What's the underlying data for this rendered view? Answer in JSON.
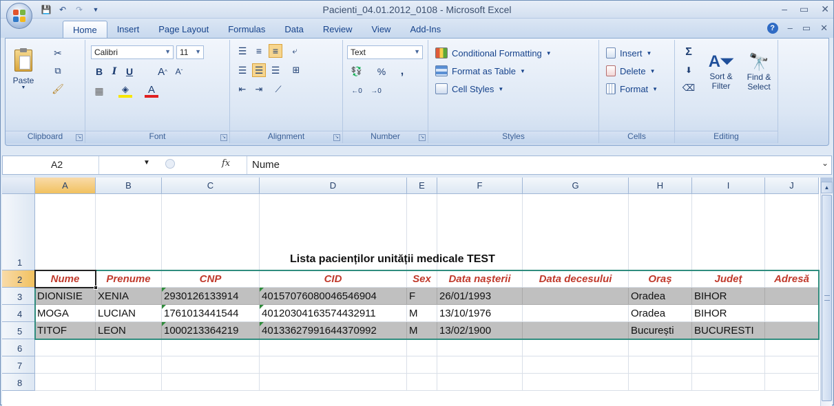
{
  "window": {
    "title": "Pacienti_04.01.2012_0108 - Microsoft Excel"
  },
  "tabs": [
    "Home",
    "Insert",
    "Page Layout",
    "Formulas",
    "Data",
    "Review",
    "View",
    "Add-Ins"
  ],
  "ribbon": {
    "clipboard": {
      "label": "Clipboard",
      "paste": "Paste"
    },
    "font": {
      "label": "Font",
      "name": "Calibri",
      "size": "11"
    },
    "alignment": {
      "label": "Alignment"
    },
    "number": {
      "label": "Number",
      "format": "Text",
      "percent": "%",
      "comma": ","
    },
    "styles": {
      "label": "Styles",
      "conditional": "Conditional Formatting",
      "format_table": "Format as Table",
      "cell_styles": "Cell Styles"
    },
    "cells": {
      "label": "Cells",
      "insert": "Insert",
      "delete": "Delete",
      "format": "Format"
    },
    "editing": {
      "label": "Editing",
      "sort_filter": "Sort &",
      "sort_filter2": "Filter",
      "find_select": "Find &",
      "find_select2": "Select"
    }
  },
  "formula_bar": {
    "name_box": "A2",
    "fx": "fx",
    "content": "Nume"
  },
  "columns": [
    "A",
    "B",
    "C",
    "D",
    "E",
    "F",
    "G",
    "H",
    "I",
    "J"
  ],
  "rows": [
    "1",
    "2",
    "3",
    "4",
    "5",
    "6",
    "7",
    "8"
  ],
  "sheet": {
    "title": "Lista pacienților unității medicale TEST",
    "headers": [
      "Nume",
      "Prenume",
      "CNP",
      "CID",
      "Sex",
      "Data nașterii",
      "Data decesului",
      "Oraș",
      "Județ",
      "Adresă"
    ],
    "records": [
      [
        "DIONISIE",
        "XENIA",
        "2930126133914",
        "40157076080046546904",
        "F",
        "26/01/1993",
        "",
        "Oradea",
        "BIHOR",
        ""
      ],
      [
        "MOGA",
        "LUCIAN",
        "1761013441544",
        "40120304163574432911",
        "M",
        "13/10/1976",
        "",
        "Oradea",
        "BIHOR",
        ""
      ],
      [
        "TITOF",
        "LEON",
        "1000213364219",
        "40133627991644370992",
        "M",
        "13/02/1900",
        "",
        "București",
        "BUCURESTI",
        ""
      ]
    ]
  },
  "colors": {
    "header_text": "#c0392b",
    "table_border": "#2f8c7e",
    "band_gray": "#c0c0c0"
  }
}
